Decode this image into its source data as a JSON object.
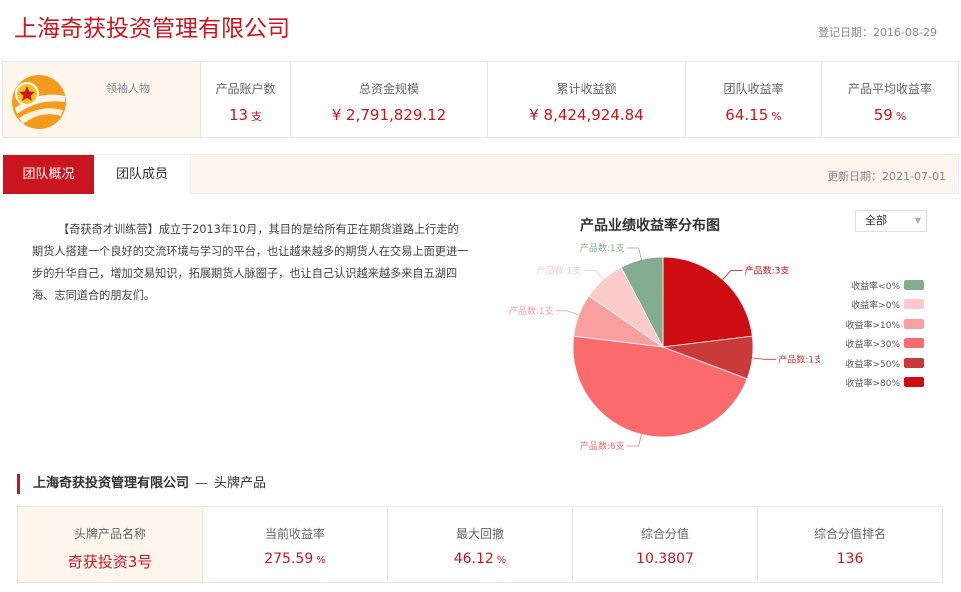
{
  "header": {
    "company": "上海奇获投资管理有限公司",
    "register_date": "登记日期：2016-08-29"
  },
  "stats": {
    "leader_label": "领袖人物",
    "items": [
      {
        "label": "产品账户数",
        "value": "13",
        "unit": "支"
      },
      {
        "label": "总资金规模",
        "value": "¥ 2,791,829.12",
        "unit": ""
      },
      {
        "label": "累计收益额",
        "value": "¥ 8,424,924.84",
        "unit": ""
      },
      {
        "label": "团队收益率",
        "value": "64.15",
        "unit": "%"
      },
      {
        "label": "产品平均收益率",
        "value": "59",
        "unit": "%"
      }
    ]
  },
  "tabs": {
    "overview": "团队概况",
    "members": "团队成员",
    "update_date": "更新日期：2021-07-01"
  },
  "description": "【奇获奇才训练营】成立于2013年10月，其目的是给所有正在期货道路上行走的 期货人搭建一个良好的交流环境与学习的平台，也让越来越多的期货人在交易上面更进一步的升华自己，增加交易知识，拓展期货人脉圈子，也让自己认识越来越多来自五湖四海、志同道合的朋友们。",
  "chart_filter": {
    "selected": "全部"
  },
  "chart_data": {
    "type": "pie",
    "title": "产品业绩收益率分布图",
    "slices": [
      {
        "name": "收益率>80%",
        "value": 3,
        "label": "产品数:3支",
        "color": "#cd0d12"
      },
      {
        "name": "收益率>50%",
        "value": 1,
        "label": "产品数:1支",
        "color": "#c93a3a"
      },
      {
        "name": "收益率>30%",
        "value": 6,
        "label": "产品数:6支",
        "color": "#fb6b6d"
      },
      {
        "name": "收益率>10%",
        "value": 1,
        "label": "产品数:1支",
        "color": "#fa9f9f"
      },
      {
        "name": "收益率>0%",
        "value": 1,
        "label": "产品数:1支",
        "color": "#fbcaca"
      },
      {
        "name": "收益率<0%",
        "value": 1,
        "label": "产品数:1支",
        "color": "#83ac91"
      }
    ],
    "legend": [
      "收益率<0%",
      "收益率>0%",
      "收益率>10%",
      "收益率>30%",
      "收益率>50%",
      "收益率>80%"
    ],
    "legend_colors": [
      "#83ac91",
      "#fbcaca",
      "#fa9f9f",
      "#fb6b6d",
      "#c93a3a",
      "#cd0d12"
    ],
    "legend_position": "right"
  },
  "flagship": {
    "company": "上海奇获投资管理有限公司",
    "separator": "—",
    "subtitle": "头牌产品",
    "cells": [
      {
        "label": "头牌产品名称",
        "value": "奇获投资3号",
        "unit": ""
      },
      {
        "label": "当前收益率",
        "value": "275.59",
        "unit": "%"
      },
      {
        "label": "最大回撤",
        "value": "46.12",
        "unit": "%"
      },
      {
        "label": "综合分值",
        "value": "10.3807",
        "unit": ""
      },
      {
        "label": "综合分值排名",
        "value": "136",
        "unit": ""
      }
    ]
  }
}
